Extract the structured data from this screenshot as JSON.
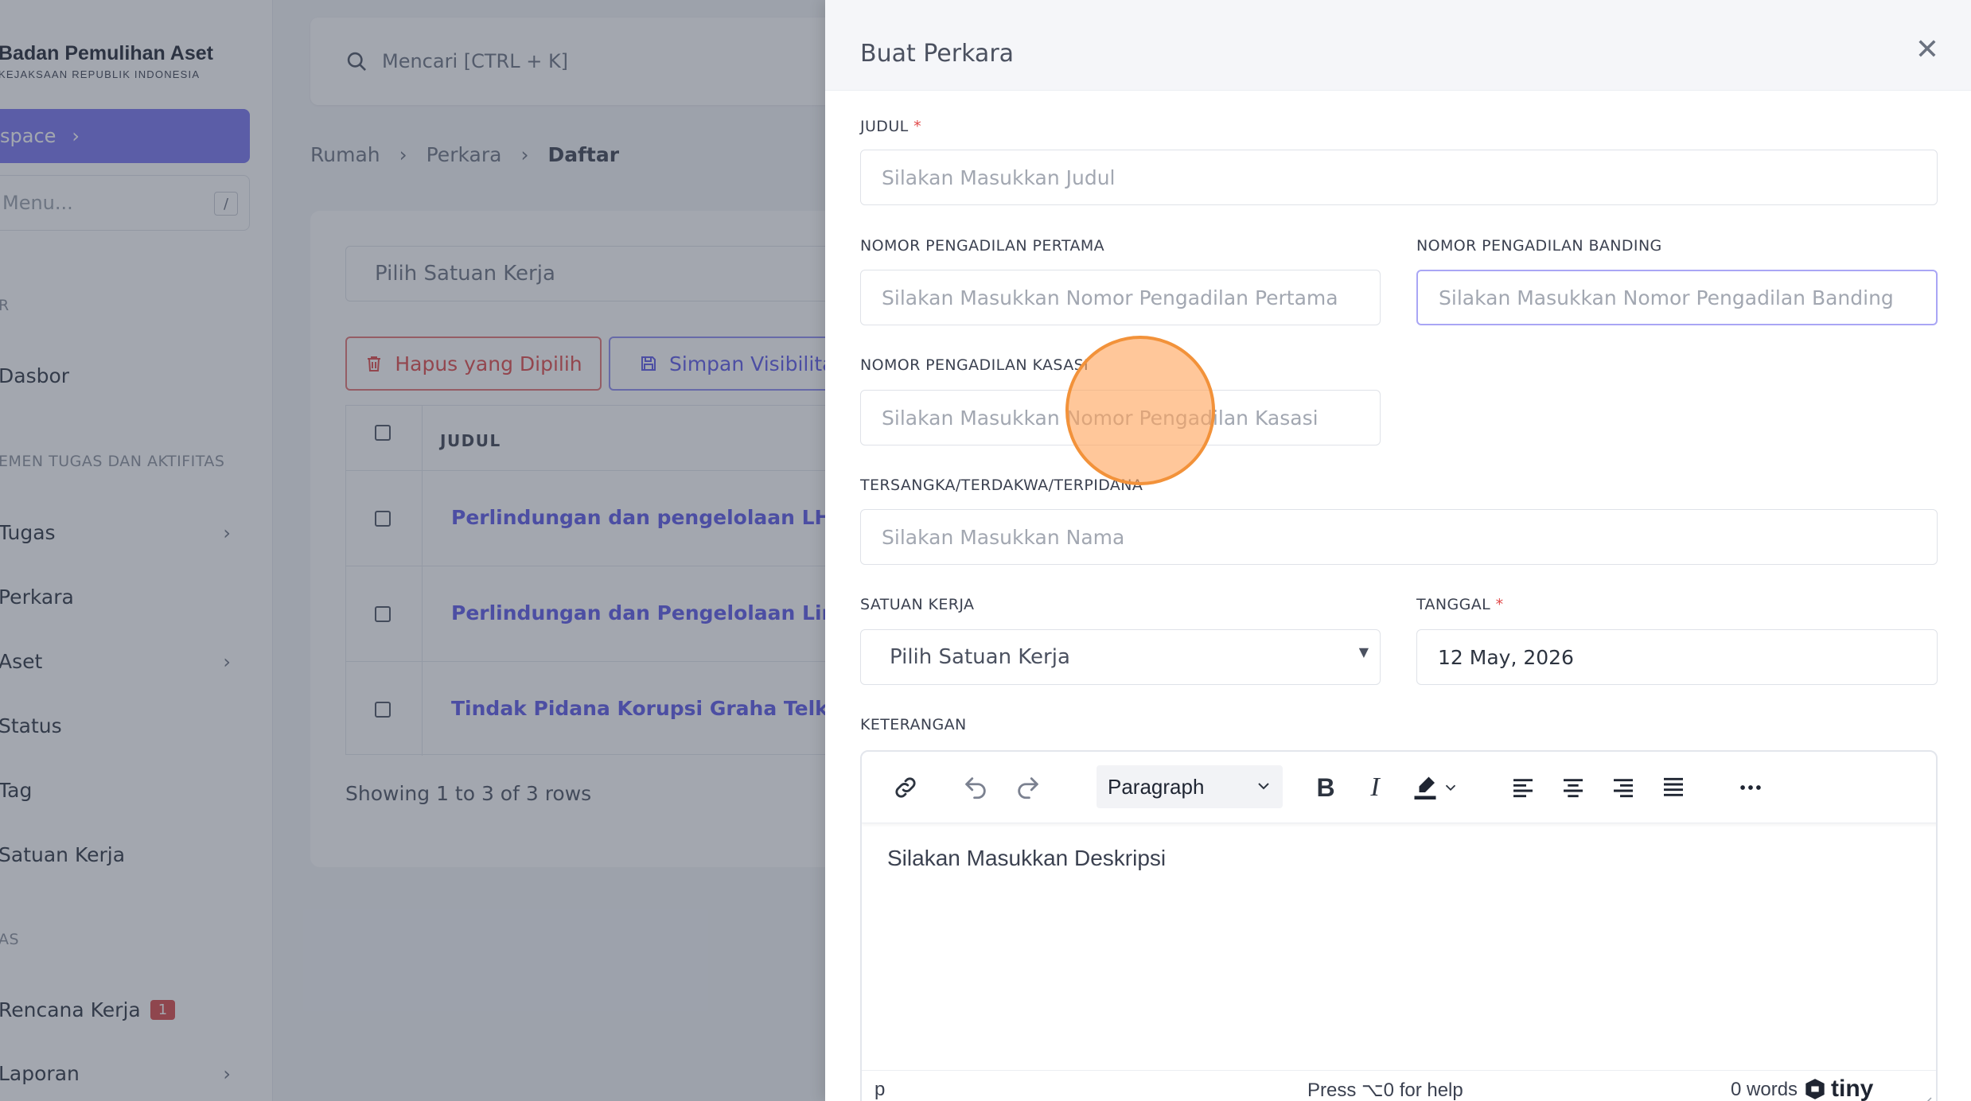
{
  "sidebar": {
    "brand_title": "Badan Pemulihan Aset",
    "brand_subtitle": "KEJAKSAAN REPUBLIK INDONESIA",
    "workspace_label": "space",
    "menu_search_placeholder": "Menu...",
    "menu_search_shortcut": "/",
    "section_1": "R",
    "section_2": "EMEN TUGAS DAN AKTIFITAS",
    "section_3": "AS",
    "items": [
      {
        "label": "Dasbor"
      },
      {
        "label": "Tugas"
      },
      {
        "label": "Perkara"
      },
      {
        "label": "Aset"
      },
      {
        "label": "Status"
      },
      {
        "label": "Tag"
      },
      {
        "label": "Satuan Kerja"
      },
      {
        "label": "Rencana Kerja",
        "badge": "1"
      },
      {
        "label": "Laporan"
      }
    ]
  },
  "topbar": {
    "search_placeholder": "Mencari [CTRL + K]"
  },
  "breadcrumb": [
    "Rumah",
    "Perkara",
    "Daftar"
  ],
  "list": {
    "unit_select": "Pilih Satuan Kerja",
    "delete_button": "Hapus yang Dipilih",
    "save_visibility_button": "Simpan Visibilitas",
    "column_title": "JUDUL",
    "rows": [
      "Perlindungan dan pengelolaan LH",
      "Perlindungan dan Pengelolaan Lingkung",
      "Tindak Pidana Korupsi Graha Telkom Sig"
    ],
    "showing": "Showing 1 to 3 of 3 rows"
  },
  "modal": {
    "title": "Buat Perkara",
    "fields": {
      "judul": {
        "label": "JUDUL",
        "placeholder": "Silakan Masukkan Judul"
      },
      "nomor_pertama": {
        "label": "NOMOR PENGADILAN PERTAMA",
        "placeholder": "Silakan Masukkan Nomor Pengadilan Pertama"
      },
      "nomor_banding": {
        "label": "NOMOR PENGADILAN BANDING",
        "placeholder": "Silakan Masukkan Nomor Pengadilan Banding"
      },
      "nomor_kasasi": {
        "label": "NOMOR PENGADILAN KASASI",
        "placeholder": "Silakan Masukkan Nomor Pengadilan Kasasi"
      },
      "tersangka": {
        "label": "TERSANGKA/TERDAKWA/TERPIDANA",
        "placeholder": "Silakan Masukkan Nama"
      },
      "satuan_kerja": {
        "label": "SATUAN KERJA",
        "value": "Pilih Satuan Kerja"
      },
      "tanggal": {
        "label": "TANGGAL",
        "value": "12 May, 2026"
      },
      "keterangan": {
        "label": "KETERANGAN"
      }
    },
    "required_mark": "*",
    "editor": {
      "block_format": "Paragraph",
      "placeholder": "Silakan Masukkan Deskripsi",
      "path": "p",
      "help": "Press ⌥0 for help",
      "word_count": "0 words",
      "logo": "tiny"
    }
  },
  "colors": {
    "accent": "#7774f0",
    "danger": "#e04848",
    "link": "#5b57e8",
    "cursor": "#f2923a"
  }
}
